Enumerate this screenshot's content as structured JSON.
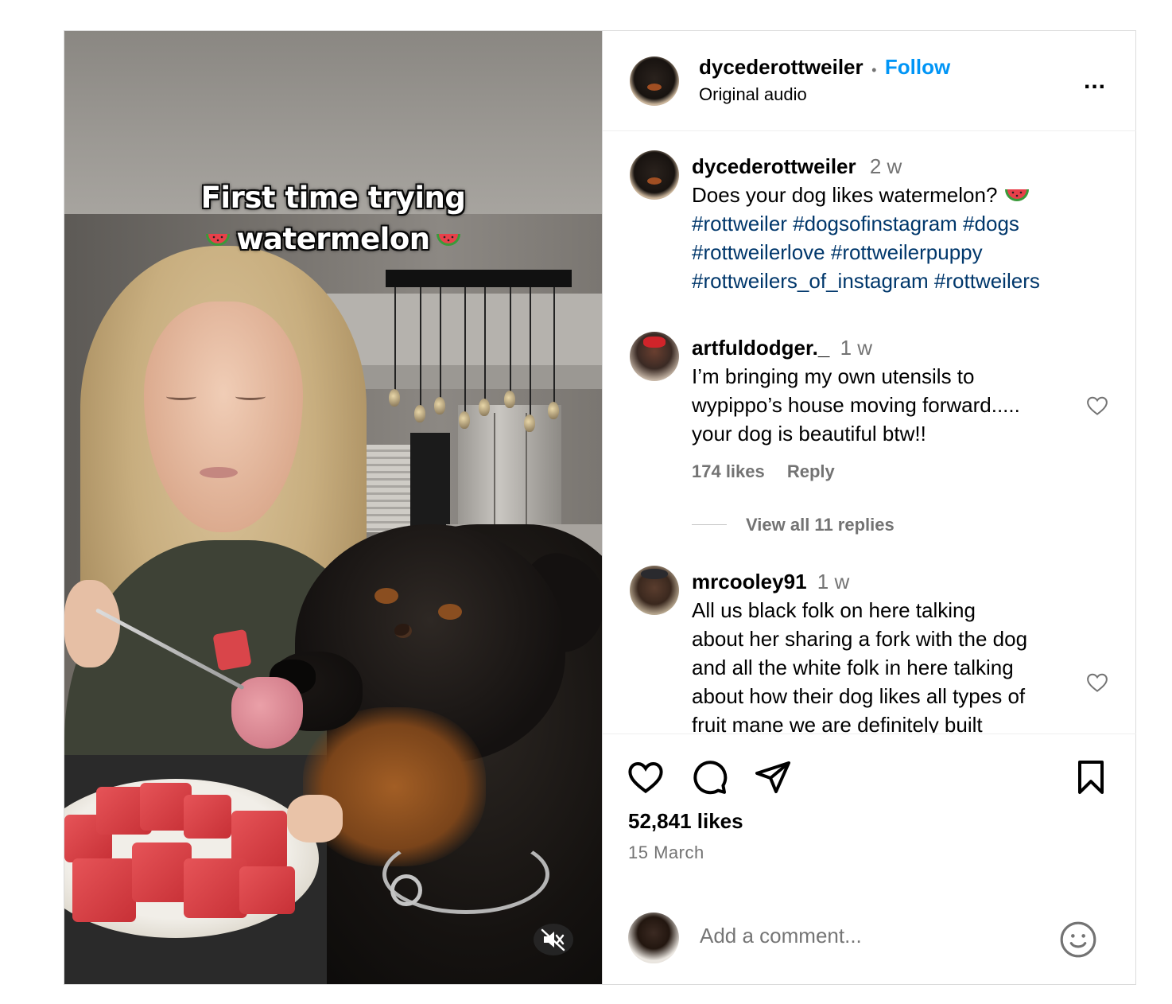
{
  "post": {
    "caption_overlay_line1": "First time trying",
    "caption_overlay_line2": "watermelon",
    "author": "dycederottweiler",
    "follow_label": "Follow",
    "dot": "•",
    "audio": "Original audio",
    "more": "...",
    "caption": {
      "username": "dycederottweiler",
      "age": "2 w",
      "text": "Does your dog likes watermelon?",
      "hashtags_line1": "#rottweiler #dogsofinstagram #dogs",
      "hashtags_line2": "#rottweilerlove #rottweilerpuppy",
      "hashtags_line3": "#rottweilers_of_instagram #rottweilers"
    },
    "comments": [
      {
        "username": "artfuldodger._",
        "age": "1 w",
        "lines": [
          "I’m bringing my own utensils to",
          "wypippo’s house moving forward.....",
          "your dog is beautiful btw!!"
        ],
        "likes": "174 likes",
        "reply_label": "Reply",
        "view_replies": "View all 11 replies"
      },
      {
        "username": "mrcooley91",
        "age": "1 w",
        "lines": [
          "All us black folk on here talking",
          "about her sharing a fork with the dog",
          "and all the white folk in here talking",
          "about how their dog likes all types of",
          "fruit mane we are definitely built"
        ]
      }
    ],
    "likes_count": "52,841 likes",
    "date": "15 March",
    "add_comment_placeholder": "Add a comment...",
    "icons": {
      "like": "heart-icon",
      "comment": "comment-icon",
      "share": "paper-plane-icon",
      "save": "bookmark-icon",
      "emoji": "emoji-icon",
      "mute": "speaker-muted-icon"
    },
    "colors": {
      "follow": "#0095f6",
      "hashtag": "#00376b",
      "secondary_text": "#737373",
      "border": "#dbdbdb"
    }
  }
}
